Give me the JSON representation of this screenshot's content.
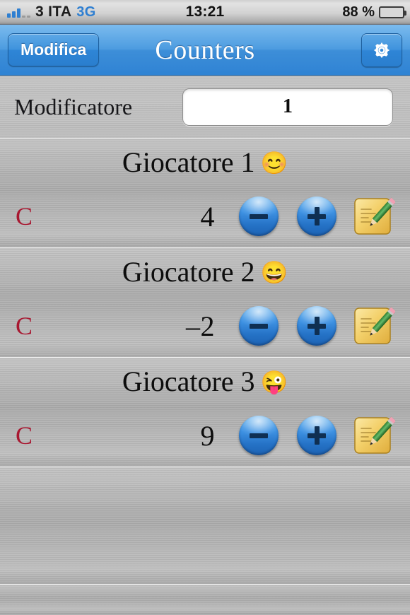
{
  "status_bar": {
    "signal_bars_filled": 3,
    "signal_bars_total": 5,
    "carrier": "3 ITA",
    "network": "3G",
    "time": "13:21",
    "battery_percent": "88 %",
    "battery_level": 88,
    "battery_color": "#5ec425"
  },
  "nav_bar": {
    "edit_label": "Modifica",
    "title": "Counters",
    "settings_icon": "gear-icon",
    "background_color": "#3d8ed8"
  },
  "modifier": {
    "label": "Modificatore",
    "value": "1",
    "placeholder": "1"
  },
  "players": [
    {
      "name": "Giocatore 1",
      "emoji": "😊",
      "emoji_name": "smiling-face-with-smiling-eyes",
      "score": "4",
      "clear_label": "C",
      "minus_label": "−",
      "plus_label": "+",
      "note_icon": "memo-pencil-icon"
    },
    {
      "name": "Giocatore 2",
      "emoji": "😄",
      "emoji_name": "grinning-face-with-smiling-eyes",
      "score": "–2",
      "clear_label": "C",
      "minus_label": "−",
      "plus_label": "+",
      "note_icon": "memo-pencil-icon"
    },
    {
      "name": "Giocatore 3",
      "emoji": "😜",
      "emoji_name": "winking-face-with-tongue",
      "score": "9",
      "clear_label": "C",
      "minus_label": "−",
      "plus_label": "+",
      "note_icon": "memo-pencil-icon"
    }
  ],
  "colors": {
    "clear_red": "#a81730",
    "button_blue": "#3f93e4",
    "note_yellow": "#f5d97a"
  }
}
